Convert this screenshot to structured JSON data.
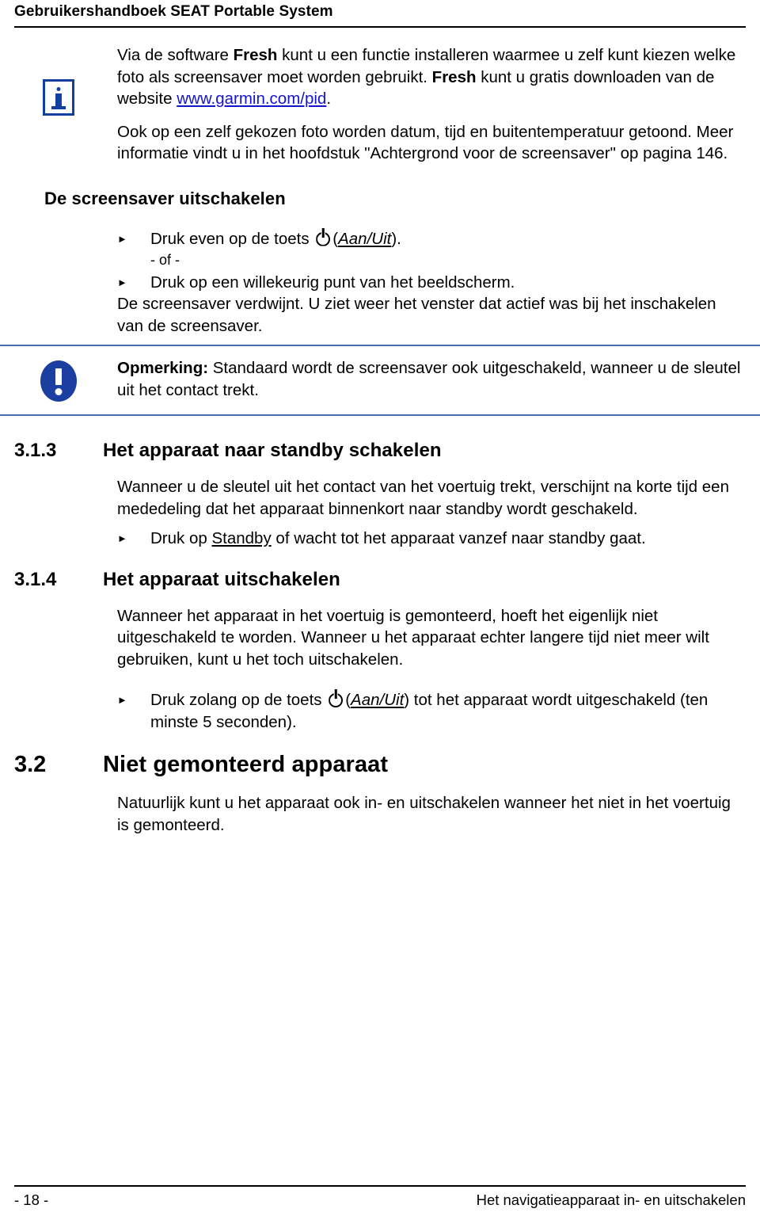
{
  "header": {
    "title": "Gebruikershandboek SEAT Portable System"
  },
  "info_box": {
    "icon": "info-icon",
    "paragraph1_part1": "Via de software ",
    "paragraph1_bold1": "Fresh",
    "paragraph1_part2": " kunt u een functie installeren waarmee u zelf kunt kiezen welke foto als screensaver moet worden gebruikt. ",
    "paragraph1_bold2": "Fresh",
    "paragraph1_part3": " kunt u gratis downloaden van de website ",
    "paragraph1_link": "www.garmin.com/pid",
    "paragraph1_part4": ".",
    "paragraph2": "Ook op een zelf gekozen foto worden datum, tijd en buitentemperatuur getoond. Meer informatie vindt u in het hoofdstuk \"Achtergrond voor de screensaver\" op pagina 146."
  },
  "section_screensaver_off": {
    "heading": "De screensaver uitschakelen",
    "bullet1_prefix": "Druk even op de toets ",
    "bullet1_icon": "power-icon",
    "bullet1_paren_open": "(",
    "bullet1_key": "Aan/Uit",
    "bullet1_paren_close": ").",
    "or_label": "- of -",
    "bullet2": "Druk op een willekeurig punt van het beeldscherm.",
    "result_text": "De screensaver verdwijnt. U ziet weer het venster dat actief was bij het inschakelen van de screensaver."
  },
  "note_box": {
    "icon": "warning-exclamation-icon",
    "label": "Opmerking:",
    "text": " Standaard wordt de screensaver ook uitgeschakeld, wanneer u de sleutel uit het contact trekt."
  },
  "sections": [
    {
      "number": "3.1.3",
      "title": "Het apparaat naar standby schakelen",
      "level": 3,
      "paragraph": "Wanneer u de sleutel uit het contact van het voertuig trekt, verschijnt na korte tijd een mededeling dat het apparaat binnenkort naar standby wordt geschakeld.",
      "bullet_prefix": "Druk op ",
      "bullet_underlined": "Standby",
      "bullet_suffix": " of wacht tot het apparaat vanzef naar standby gaat."
    },
    {
      "number": "3.1.4",
      "title": "Het apparaat uitschakelen",
      "level": 3,
      "paragraph": "Wanneer het apparaat in het voertuig is gemonteerd, hoeft het eigenlijk niet uitgeschakeld te worden. Wanneer u het apparaat echter langere tijd niet meer wilt gebruiken, kunt u het toch uitschakelen.",
      "bullet_prefix": "Druk zolang op de toets ",
      "bullet_icon": "power-icon",
      "bullet_paren_open": "(",
      "bullet_key": "Aan/Uit",
      "bullet_suffix": ") tot het apparaat wordt uitgeschakeld (ten minste 5 seconden)."
    },
    {
      "number": "3.2",
      "title": "Niet gemonteerd apparaat",
      "level": 2,
      "paragraph": "Natuurlijk kunt u het apparaat ook in- en uitschakelen wanneer het niet in het voertuig is gemonteerd."
    }
  ],
  "footer": {
    "page_number": "- 18 -",
    "chapter_title": "Het navigatieapparaat in- en uitschakelen"
  },
  "colors": {
    "link": "#1414cc",
    "info_icon": "#1340a0",
    "note_icon": "#1a3fa0",
    "note_rule": "#4a6fa8",
    "rule": "#000000"
  }
}
